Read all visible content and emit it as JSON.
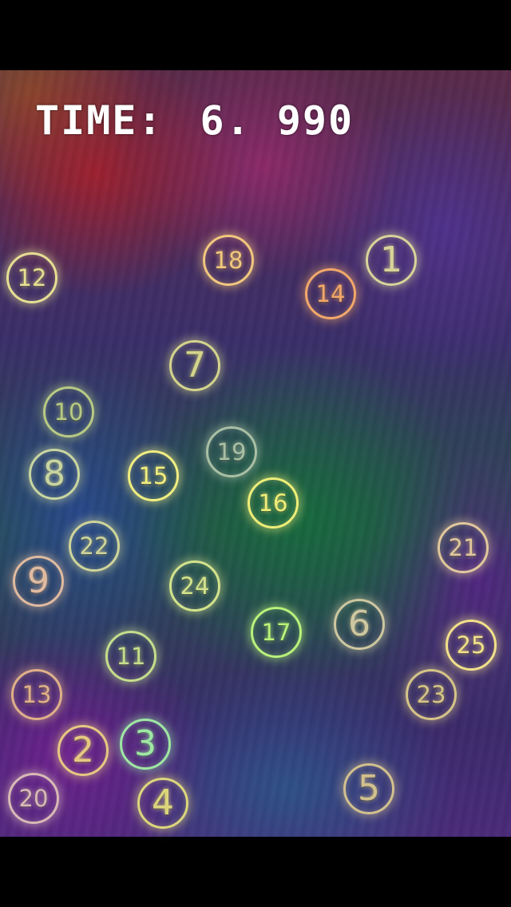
{
  "timer": {
    "label": "TIME:",
    "value": "6. 990"
  },
  "bubbles": [
    {
      "number": "1",
      "color": "#d8d39a"
    },
    {
      "number": "2",
      "color": "#e6c882"
    },
    {
      "number": "3",
      "color": "#9fe7a4"
    },
    {
      "number": "4",
      "color": "#dcd67c"
    },
    {
      "number": "5",
      "color": "#d2c08e"
    },
    {
      "number": "6",
      "color": "#cdc7a0"
    },
    {
      "number": "7",
      "color": "#d4d48c"
    },
    {
      "number": "8",
      "color": "#c9d5a0"
    },
    {
      "number": "9",
      "color": "#e0bba0"
    },
    {
      "number": "10",
      "color": "#b8ca84"
    },
    {
      "number": "11",
      "color": "#c5dd8c"
    },
    {
      "number": "12",
      "color": "#e6df92"
    },
    {
      "number": "13",
      "color": "#dfb089"
    },
    {
      "number": "14",
      "color": "#f2a86a"
    },
    {
      "number": "15",
      "color": "#f0ee80"
    },
    {
      "number": "16",
      "color": "#eeee78"
    },
    {
      "number": "17",
      "color": "#b8f27a"
    },
    {
      "number": "18",
      "color": "#f2c77e"
    },
    {
      "number": "19",
      "color": "#a9bfa4"
    },
    {
      "number": "20",
      "color": "#d8b9b6"
    },
    {
      "number": "21",
      "color": "#e1c79b"
    },
    {
      "number": "22",
      "color": "#cfd49a"
    },
    {
      "number": "23",
      "color": "#d6c488"
    },
    {
      "number": "24",
      "color": "#d3e38c"
    },
    {
      "number": "25",
      "color": "#f2e08a"
    }
  ]
}
